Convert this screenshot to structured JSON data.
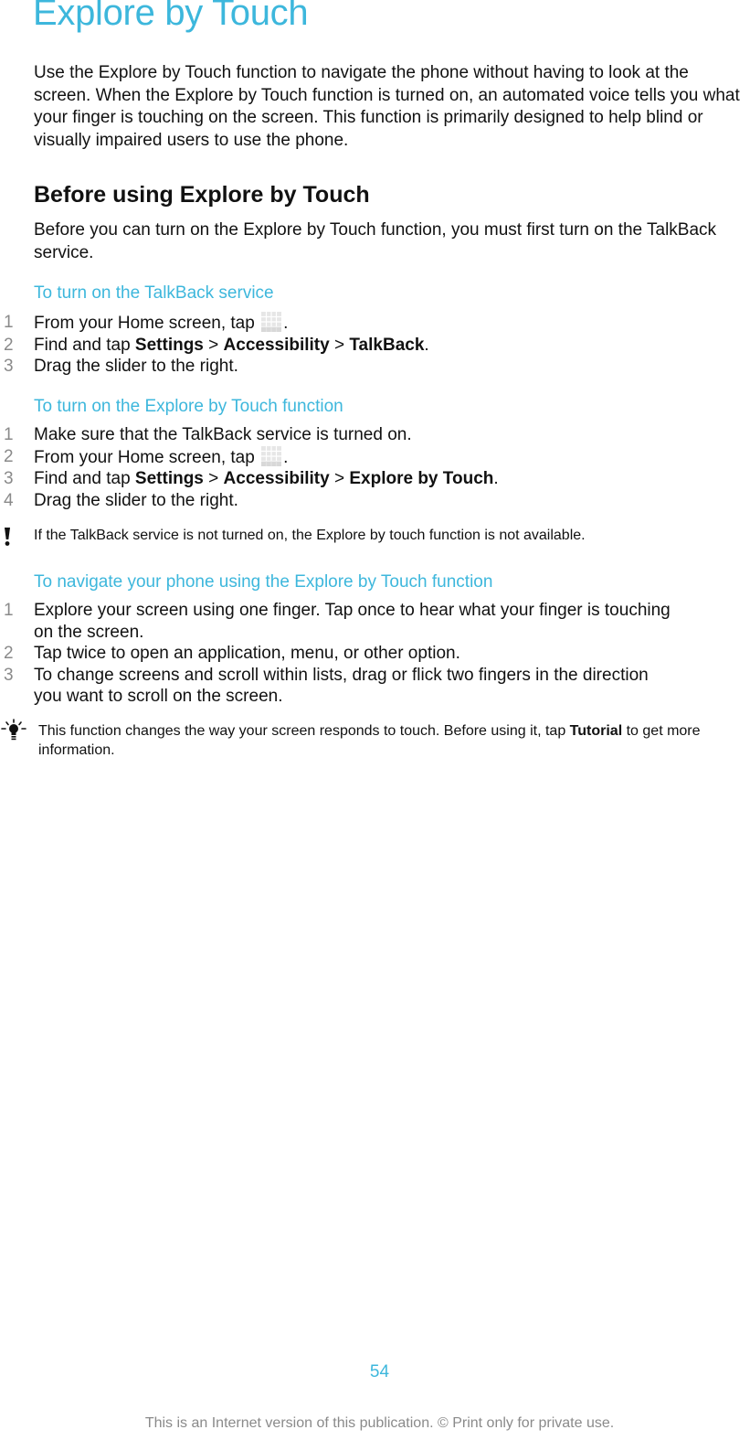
{
  "page": {
    "title": "Explore by Touch",
    "intro": "Use the Explore by Touch function to navigate the phone without having to look at the screen. When the Explore by Touch function is turned on, an automated voice tells you what your finger is touching on the screen. This function is primarily designed to help blind or visually impaired users to use the phone.",
    "section": {
      "heading": "Before using Explore by Touch",
      "text": "Before you can turn on the Explore by Touch function, you must first turn on the TalkBack service."
    },
    "procedures": [
      {
        "title": "To turn on the TalkBack service",
        "steps": [
          {
            "num": "1",
            "text_before": "From your Home screen, tap ",
            "icon": "app-grid-icon",
            "text_after": "."
          },
          {
            "num": "2",
            "text_before": "Find and tap ",
            "bold1": "Settings",
            "sep1": " > ",
            "bold2": "Accessibility",
            "sep2": " > ",
            "bold3": "TalkBack",
            "text_after": "."
          },
          {
            "num": "3",
            "text": "Drag the slider to the right."
          }
        ]
      },
      {
        "title": "To turn on the Explore by Touch function",
        "steps": [
          {
            "num": "1",
            "text": "Make sure that the TalkBack service is turned on."
          },
          {
            "num": "2",
            "text_before": "From your Home screen, tap ",
            "icon": "app-grid-icon",
            "text_after": "."
          },
          {
            "num": "3",
            "text_before": "Find and tap ",
            "bold1": "Settings",
            "sep1": " > ",
            "bold2": "Accessibility",
            "sep2": " > ",
            "bold3": "Explore by Touch",
            "text_after": "."
          },
          {
            "num": "4",
            "text": "Drag the slider to the right."
          }
        ]
      },
      {
        "title": "To navigate your phone using the Explore by Touch function",
        "steps": [
          {
            "num": "1",
            "text": "Explore your screen using one finger. Tap once to hear what your finger is touching on the screen."
          },
          {
            "num": "2",
            "text": "Tap twice to open an application, menu, or other option."
          },
          {
            "num": "3",
            "text": "To change screens and scroll within lists, drag or flick two fingers in the direction you want to scroll on the screen."
          }
        ]
      }
    ],
    "warning_note": {
      "icon": "exclamation-icon",
      "text": "If the TalkBack service is not turned on, the Explore by touch function is not available."
    },
    "tip_note": {
      "icon": "lightbulb-icon",
      "text_before": "This function changes the way your screen responds to touch. Before using it, tap ",
      "bold": "Tutorial",
      "text_after": " to get more information."
    },
    "page_number": "54",
    "footer": "This is an Internet version of this publication. © Print only for private use."
  },
  "colors": {
    "accent": "#3db7dc",
    "text": "#111111",
    "muted": "#8a8a8a"
  }
}
